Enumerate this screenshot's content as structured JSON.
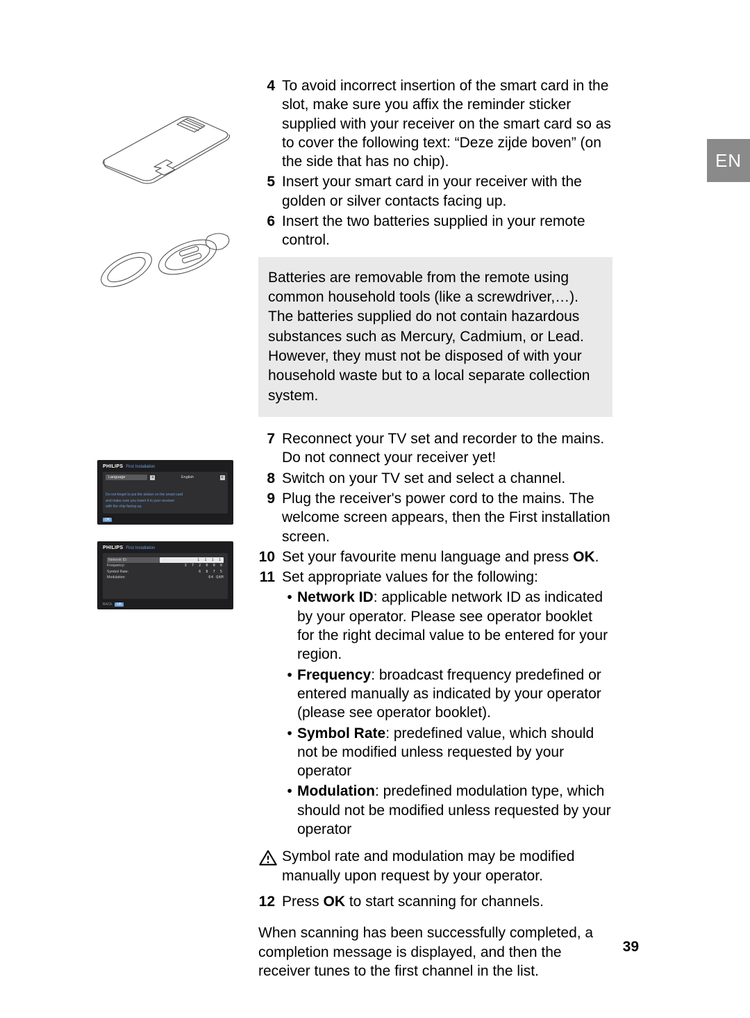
{
  "lang_tab": "EN",
  "page_number": "39",
  "steps": {
    "s4": "To avoid incorrect insertion of the smart card in the slot, make sure you affix the reminder sticker supplied with your receiver on the smart card so as to cover the following text: “Deze zijde boven” (on the side that has no chip).",
    "s5": "Insert your smart card in your receiver with the golden or silver contacts facing up.",
    "s6": "Insert the two batteries supplied in your remote control.",
    "s7": "Reconnect your TV set and recorder to the mains. Do not connect your receiver yet!",
    "s8": "Switch on your TV set and select a channel.",
    "s9": "Plug the receiver's power cord to the mains. The welcome screen appears, then the First installation screen.",
    "s10_pre": "Set your favourite menu language and press ",
    "s10_bold": "OK",
    "s10_post": ".",
    "s11": "Set appropriate values for the following:",
    "s12_pre": "Press ",
    "s12_bold": "OK",
    "s12_post": " to start scanning for channels."
  },
  "infobox": "Batteries are removable from the remote using common household tools (like a screwdriver,…). The batteries supplied do not contain hazardous substances such as Mercury, Cadmium, or Lead. However, they must not be disposed of with your household waste but to a local separate collection system.",
  "bullets": {
    "network_id": {
      "label": "Network ID",
      "text": ": applicable network ID as indicated by your operator. Please see operator booklet for the right decimal value to be entered for your region."
    },
    "frequency": {
      "label": "Frequency",
      "text": ": broadcast frequency predefined or entered manually as indicated by your operator (please see operator booklet)."
    },
    "symbol_rate": {
      "label": "Symbol Rate",
      "text": ": predefined value, which should not be modified unless requested by your operator"
    },
    "modulation": {
      "label": "Modulation",
      "text": ": predefined modulation type, which should not be modified unless requested by your operator"
    }
  },
  "warning": "Symbol rate and modulation may be modified manually upon request by your operator.",
  "closing": "When scanning has been successfully completed, a completion message is displayed, and then the receiver tunes to the first channel in the list.",
  "tv": {
    "brand": "PHILIPS",
    "title": "First Installation",
    "language_lbl": "Language",
    "language_val": "English",
    "note1": "Do not forget to put the sticker on the smart card",
    "note2": "and make sure you insert it in your receiver",
    "note3": "with the chip facing up.",
    "ok": "OK",
    "rows": {
      "network_id": {
        "lbl": "Network ID:",
        "val": "1 1 1 1"
      },
      "frequency": {
        "lbl": "Frequency:",
        "val": "3 7 2 0 0 0"
      },
      "symbol_rate": {
        "lbl": "Symbol Rate:",
        "val": "6 8 7 5"
      },
      "modulation": {
        "lbl": "Modulation:",
        "val": "64 QAM"
      }
    },
    "back": "BACK"
  }
}
